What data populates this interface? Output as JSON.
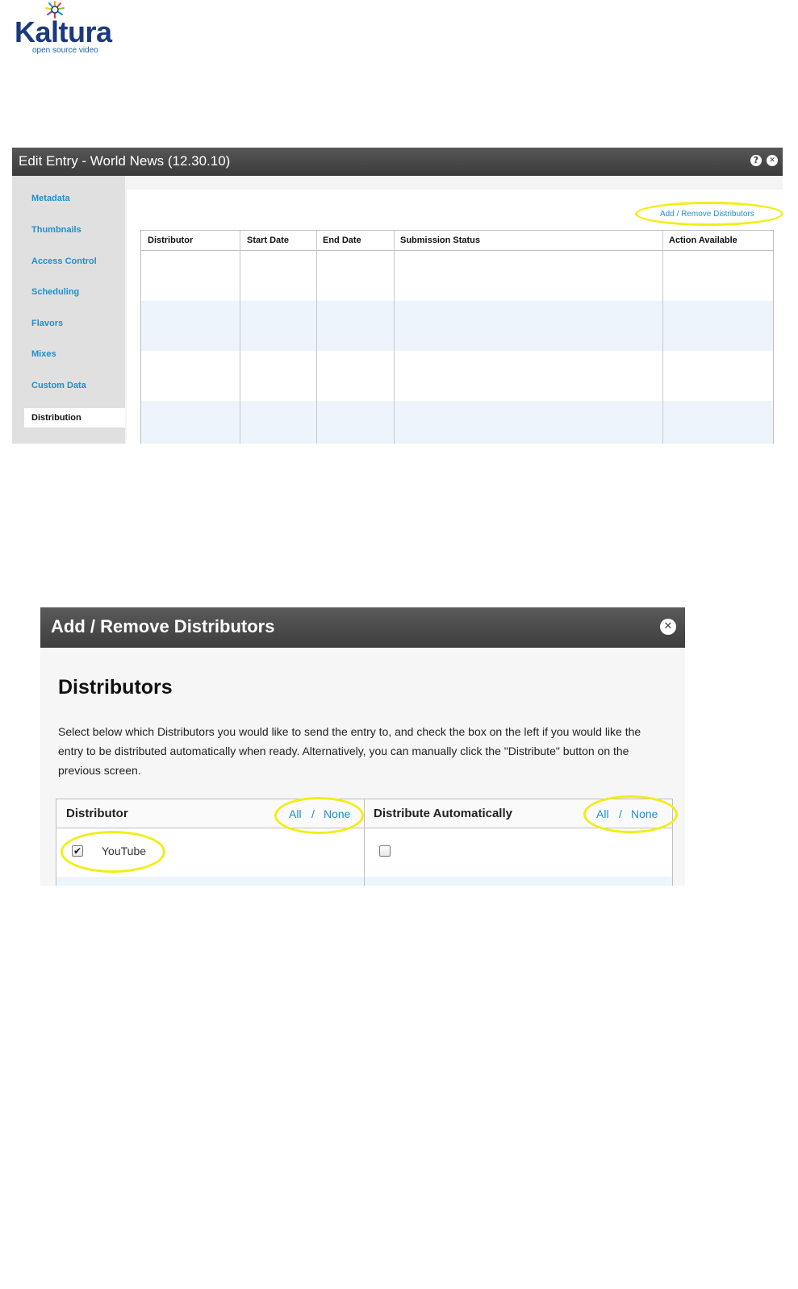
{
  "logo": {
    "name": "Kaltura",
    "tagline": "open source video",
    "burst_colors": [
      "#f6a11a",
      "#e23b3b",
      "#8dc63f",
      "#1e8fcf",
      "#7b4fa0",
      "#f2d50f"
    ]
  },
  "edit_entry": {
    "title": "Edit Entry - World News (12.30.10)",
    "help_icon": "?",
    "close_icon": "✕",
    "sidebar": [
      {
        "label": "Metadata"
      },
      {
        "label": "Thumbnails"
      },
      {
        "label": "Access Control"
      },
      {
        "label": "Scheduling"
      },
      {
        "label": "Flavors"
      },
      {
        "label": "Mixes"
      },
      {
        "label": "Custom Data"
      },
      {
        "label": "Distribution",
        "active": true
      }
    ],
    "add_remove_link": "Add / Remove Distributors",
    "table": {
      "columns": [
        "Distributor",
        "Start Date",
        "End Date",
        "Submission Status",
        "Action Available"
      ],
      "rows": []
    }
  },
  "add_remove_dialog": {
    "title": "Add / Remove Distributors",
    "close_icon": "✕",
    "heading": "Distributors",
    "description": "Select below which Distributors you would like to send the entry to, and check the box on the left if you would like the entry to be distributed automatically when ready. Alternatively, you can manually click the \"Distribute\" button on the previous screen.",
    "columns": {
      "distributor": "Distributor",
      "distribute_automatically": "Distribute Automatically"
    },
    "select_all": "All",
    "separator": "/",
    "select_none": "None",
    "rows": [
      {
        "name": "YouTube",
        "selected": true,
        "distribute_automatically": false
      }
    ]
  },
  "highlight_color": "#f2ee15",
  "link_color": "#1e8fcf"
}
